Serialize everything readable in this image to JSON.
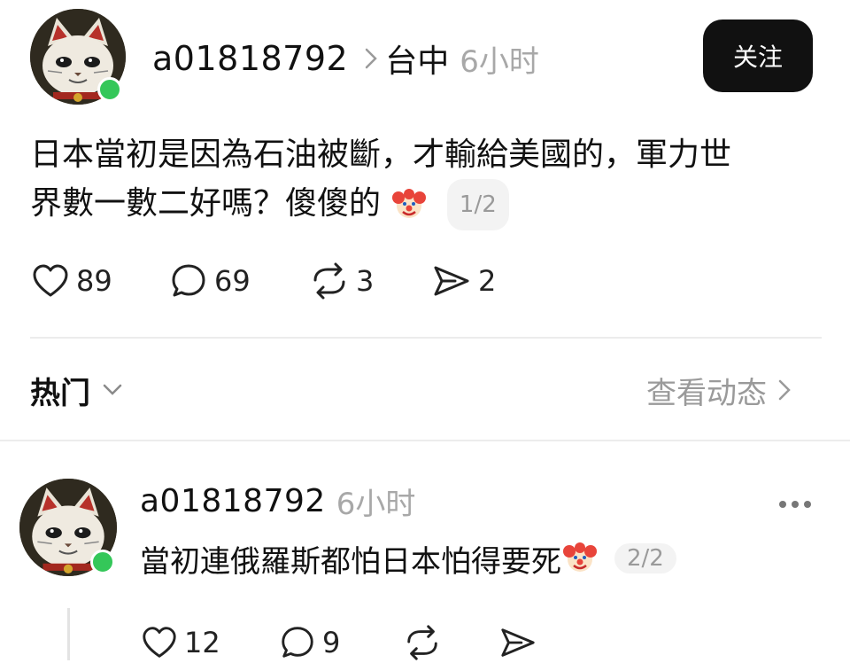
{
  "post": {
    "username": "a01818792",
    "location": "台中",
    "time": "6小时",
    "follow_label": "关注",
    "text_line1": "日本當初是因為石油被斷，才輸給美國的，軍力世",
    "text_line2": "界數一數二好嗎？傻傻的",
    "pager": "1/2",
    "likes": "89",
    "comments": "69",
    "reposts": "3",
    "shares": "2"
  },
  "section": {
    "hot_label": "热门",
    "view_activity": "查看动态"
  },
  "reply": {
    "username": "a01818792",
    "time": "6小时",
    "text": "當初連俄羅斯都怕日本怕得要死",
    "pager": "2/2",
    "likes": "12",
    "comments": "9"
  },
  "colors": {
    "online": "#34c759",
    "button_bg": "#111111",
    "muted": "#a8a8a8"
  },
  "icons": [
    "cat-avatar",
    "clown-emoji",
    "heart-icon",
    "comment-icon",
    "repost-icon",
    "share-icon",
    "chevron-right-icon",
    "chevron-down-icon",
    "more-dots-icon"
  ]
}
